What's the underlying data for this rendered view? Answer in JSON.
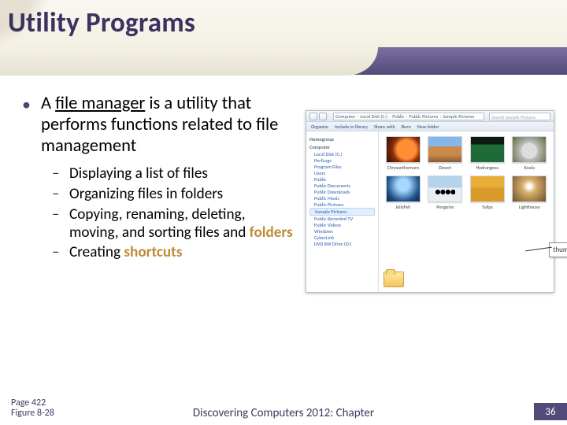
{
  "title": "Utility Programs",
  "main_bullet": {
    "prefix": "A ",
    "term": "file manager",
    "rest": " is a utility that performs functions related to file management"
  },
  "sub_bullets": [
    "Displaying a list of files",
    "Organizing files in folders"
  ],
  "sub_bullet_3": {
    "part1": "Copying, renaming, deleting, moving, and sorting files and ",
    "accent": "folders"
  },
  "sub_bullet_4": {
    "part1": "Creating ",
    "accent": "shortcuts"
  },
  "figure": {
    "breadcrumb": [
      "Computer",
      "Local Disk (C:)",
      "Public",
      "Public Pictures",
      "Sample Pictures"
    ],
    "search_placeholder": "Search Sample Pictures",
    "toolbar": [
      "Organize",
      "Include in library",
      "Share with",
      "Burn",
      "New folder"
    ],
    "sidebar": {
      "headers": [
        "Homegroup",
        "Computer"
      ],
      "computer_items": [
        "Local Disk (C:)",
        "PerfLogs",
        "Program Files",
        "Users",
        "Public",
        "Public Documents",
        "Public Downloads",
        "Public Music",
        "Public Pictures",
        "Sample Pictures",
        "Public Recorded TV",
        "Public Videos",
        "Windows",
        "CyberLink",
        "DVD RW Drive (D:)"
      ]
    },
    "thumbs": [
      "Chrysanthemum",
      "Desert",
      "Hydrangeas",
      "Koala",
      "Jellyfish",
      "Penguins",
      "Tulips",
      "Lighthouse"
    ],
    "callout": "thumbnail"
  },
  "footer": {
    "page": "Page 422",
    "figure": "Figure 8-28",
    "center": "Discovering Computers 2012: Chapter",
    "slide_number": "36"
  }
}
